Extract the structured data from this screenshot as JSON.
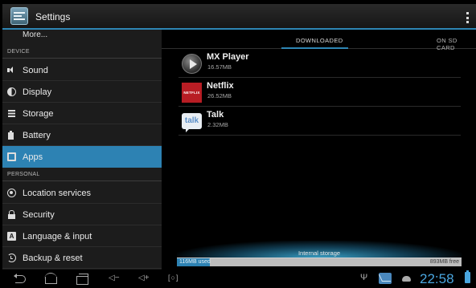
{
  "header": {
    "title": "Settings",
    "app_icon": "settings-icon",
    "menu_icon": "overflow-menu-icon"
  },
  "sidebar": {
    "more_label": "More...",
    "sections": [
      {
        "label": "DEVICE"
      },
      {
        "label": "PERSONAL"
      }
    ],
    "items": [
      {
        "label": "Sound",
        "icon": "speaker-icon"
      },
      {
        "label": "Display",
        "icon": "display-icon"
      },
      {
        "label": "Storage",
        "icon": "storage-icon"
      },
      {
        "label": "Battery",
        "icon": "battery-icon"
      },
      {
        "label": "Apps",
        "icon": "apps-icon",
        "selected": true
      },
      {
        "label": "Location services",
        "icon": "location-icon"
      },
      {
        "label": "Security",
        "icon": "lock-icon"
      },
      {
        "label": "Language & input",
        "icon": "language-icon"
      },
      {
        "label": "Backup & reset",
        "icon": "backup-icon"
      }
    ]
  },
  "main": {
    "tabs": [
      {
        "label": "DOWNLOADED",
        "selected": true
      },
      {
        "label": "ON SD CARD"
      }
    ],
    "apps": [
      {
        "name": "MX Player",
        "size": "16.57MB",
        "icon": "mx-player-icon"
      },
      {
        "name": "Netflix",
        "size": "26.52MB",
        "icon": "netflix-icon",
        "icon_text": "NETFLIX"
      },
      {
        "name": "Talk",
        "size": "2.32MB",
        "icon": "talk-icon",
        "icon_text": "talk"
      }
    ],
    "storage": {
      "title": "Internal storage",
      "used_label": "116MB used",
      "free_label": "893MB free",
      "used_mb": 116,
      "free_mb": 893
    }
  },
  "system_bar": {
    "vol_down": "◁−",
    "vol_up": "◁+",
    "screenshot": "[○]",
    "usb": "Ψ",
    "time": "22:58"
  },
  "colors": {
    "accent": "#2d82b3",
    "clock": "#4aa6df",
    "sidebar_bg": "#1c1c1c"
  }
}
